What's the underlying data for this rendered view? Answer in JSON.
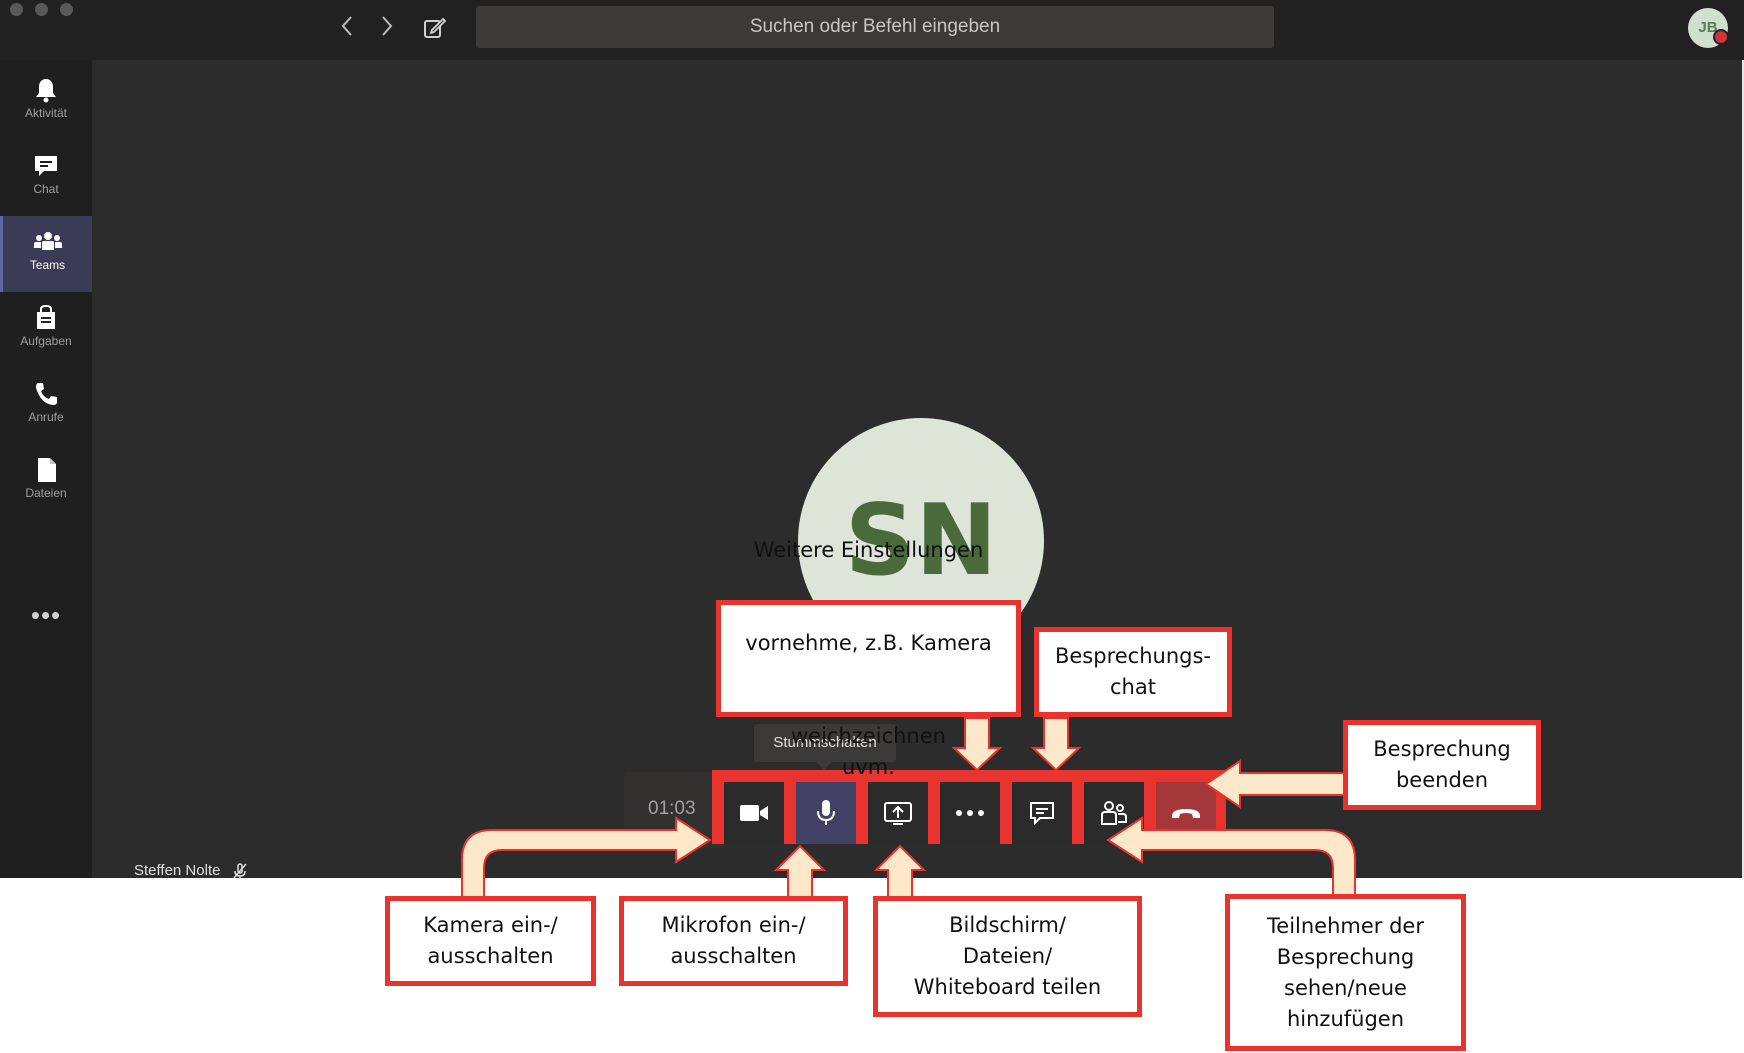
{
  "titlebar": {
    "search_placeholder": "Suchen oder Befehl eingeben",
    "user_initials": "JB"
  },
  "rail": {
    "items": [
      {
        "label": "Aktivität",
        "icon": "bell-icon"
      },
      {
        "label": "Chat",
        "icon": "chat-icon"
      },
      {
        "label": "Teams",
        "icon": "teams-icon",
        "active": true
      },
      {
        "label": "Aufgaben",
        "icon": "assignments-icon"
      },
      {
        "label": "Anrufe",
        "icon": "phone-icon"
      },
      {
        "label": "Dateien",
        "icon": "file-icon"
      }
    ],
    "more": "•••"
  },
  "meeting": {
    "participant_initials": "SN",
    "participant_name": "Steffen Nolte",
    "timer": "01:03",
    "tooltip": "Stummschalten",
    "controls": [
      {
        "name": "camera",
        "icon": "video-camera-icon"
      },
      {
        "name": "mic",
        "icon": "microphone-icon",
        "active": true
      },
      {
        "name": "share",
        "icon": "share-screen-icon"
      },
      {
        "name": "more",
        "icon": "more-options-icon"
      },
      {
        "name": "chat",
        "icon": "chat-icon"
      },
      {
        "name": "participants",
        "icon": "participants-icon"
      },
      {
        "name": "hangup",
        "icon": "hang-up-icon"
      }
    ]
  },
  "callouts": {
    "settings_line1": "Weitere Einstellungen",
    "settings_line2": "vornehme, z.B. Kamera",
    "settings_line3a": "weichzeichnen ",
    "settings_line3b": "uvm.",
    "chat": "Besprechungs-\nchat",
    "end": "Besprechung\nbeenden",
    "camera": "Kamera ein-/\nausschalten",
    "mic": "Mikrofon ein-/\nausschalten",
    "share": "Bildschirm/\nDateien/\nWhiteboard teilen",
    "participants": "Teilnehmer der\nBesprechung\nsehen/neue\nhinzufügen"
  },
  "colors": {
    "callout_border": "#e8332e",
    "arrow_fill": "#fde8c9",
    "arrow_stroke": "#e8332e",
    "hangup": "#a4373a"
  }
}
